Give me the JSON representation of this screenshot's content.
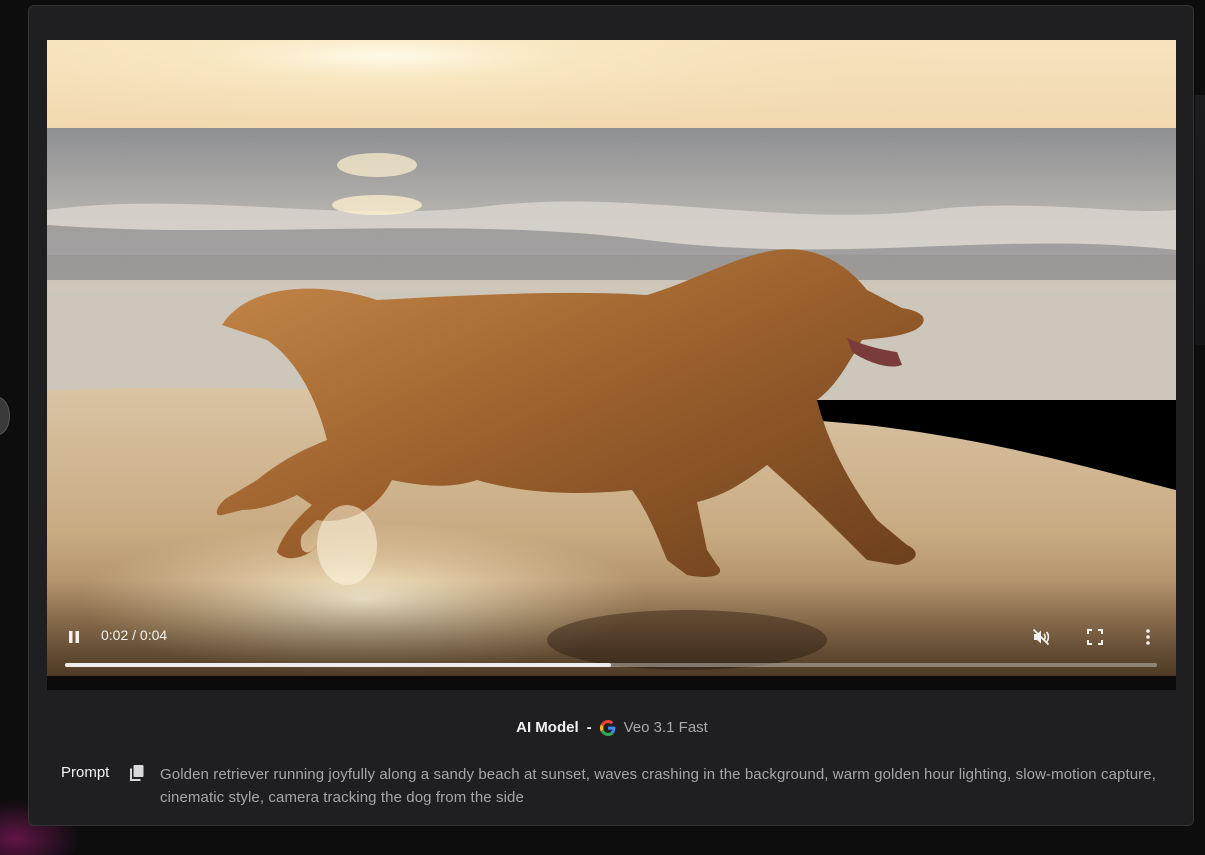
{
  "player": {
    "time_display": "0:02 / 0:04",
    "progress": 0.5
  },
  "model": {
    "label": "AI Model",
    "separator": "-",
    "provider_icon": "google-g-icon",
    "name": "Veo 3.1 Fast"
  },
  "prompt": {
    "label": "Prompt",
    "copy_icon": "copy-icon",
    "text": "Golden retriever running joyfully along a sandy beach at sunset, waves crashing in the background, warm golden hour lighting, slow-motion capture, cinematic style, camera tracking the dog from the side"
  },
  "colors": {
    "card_bg": "#1f1f21",
    "page_bg": "#0d0d0e",
    "muted_text": "#a6a6aa"
  }
}
